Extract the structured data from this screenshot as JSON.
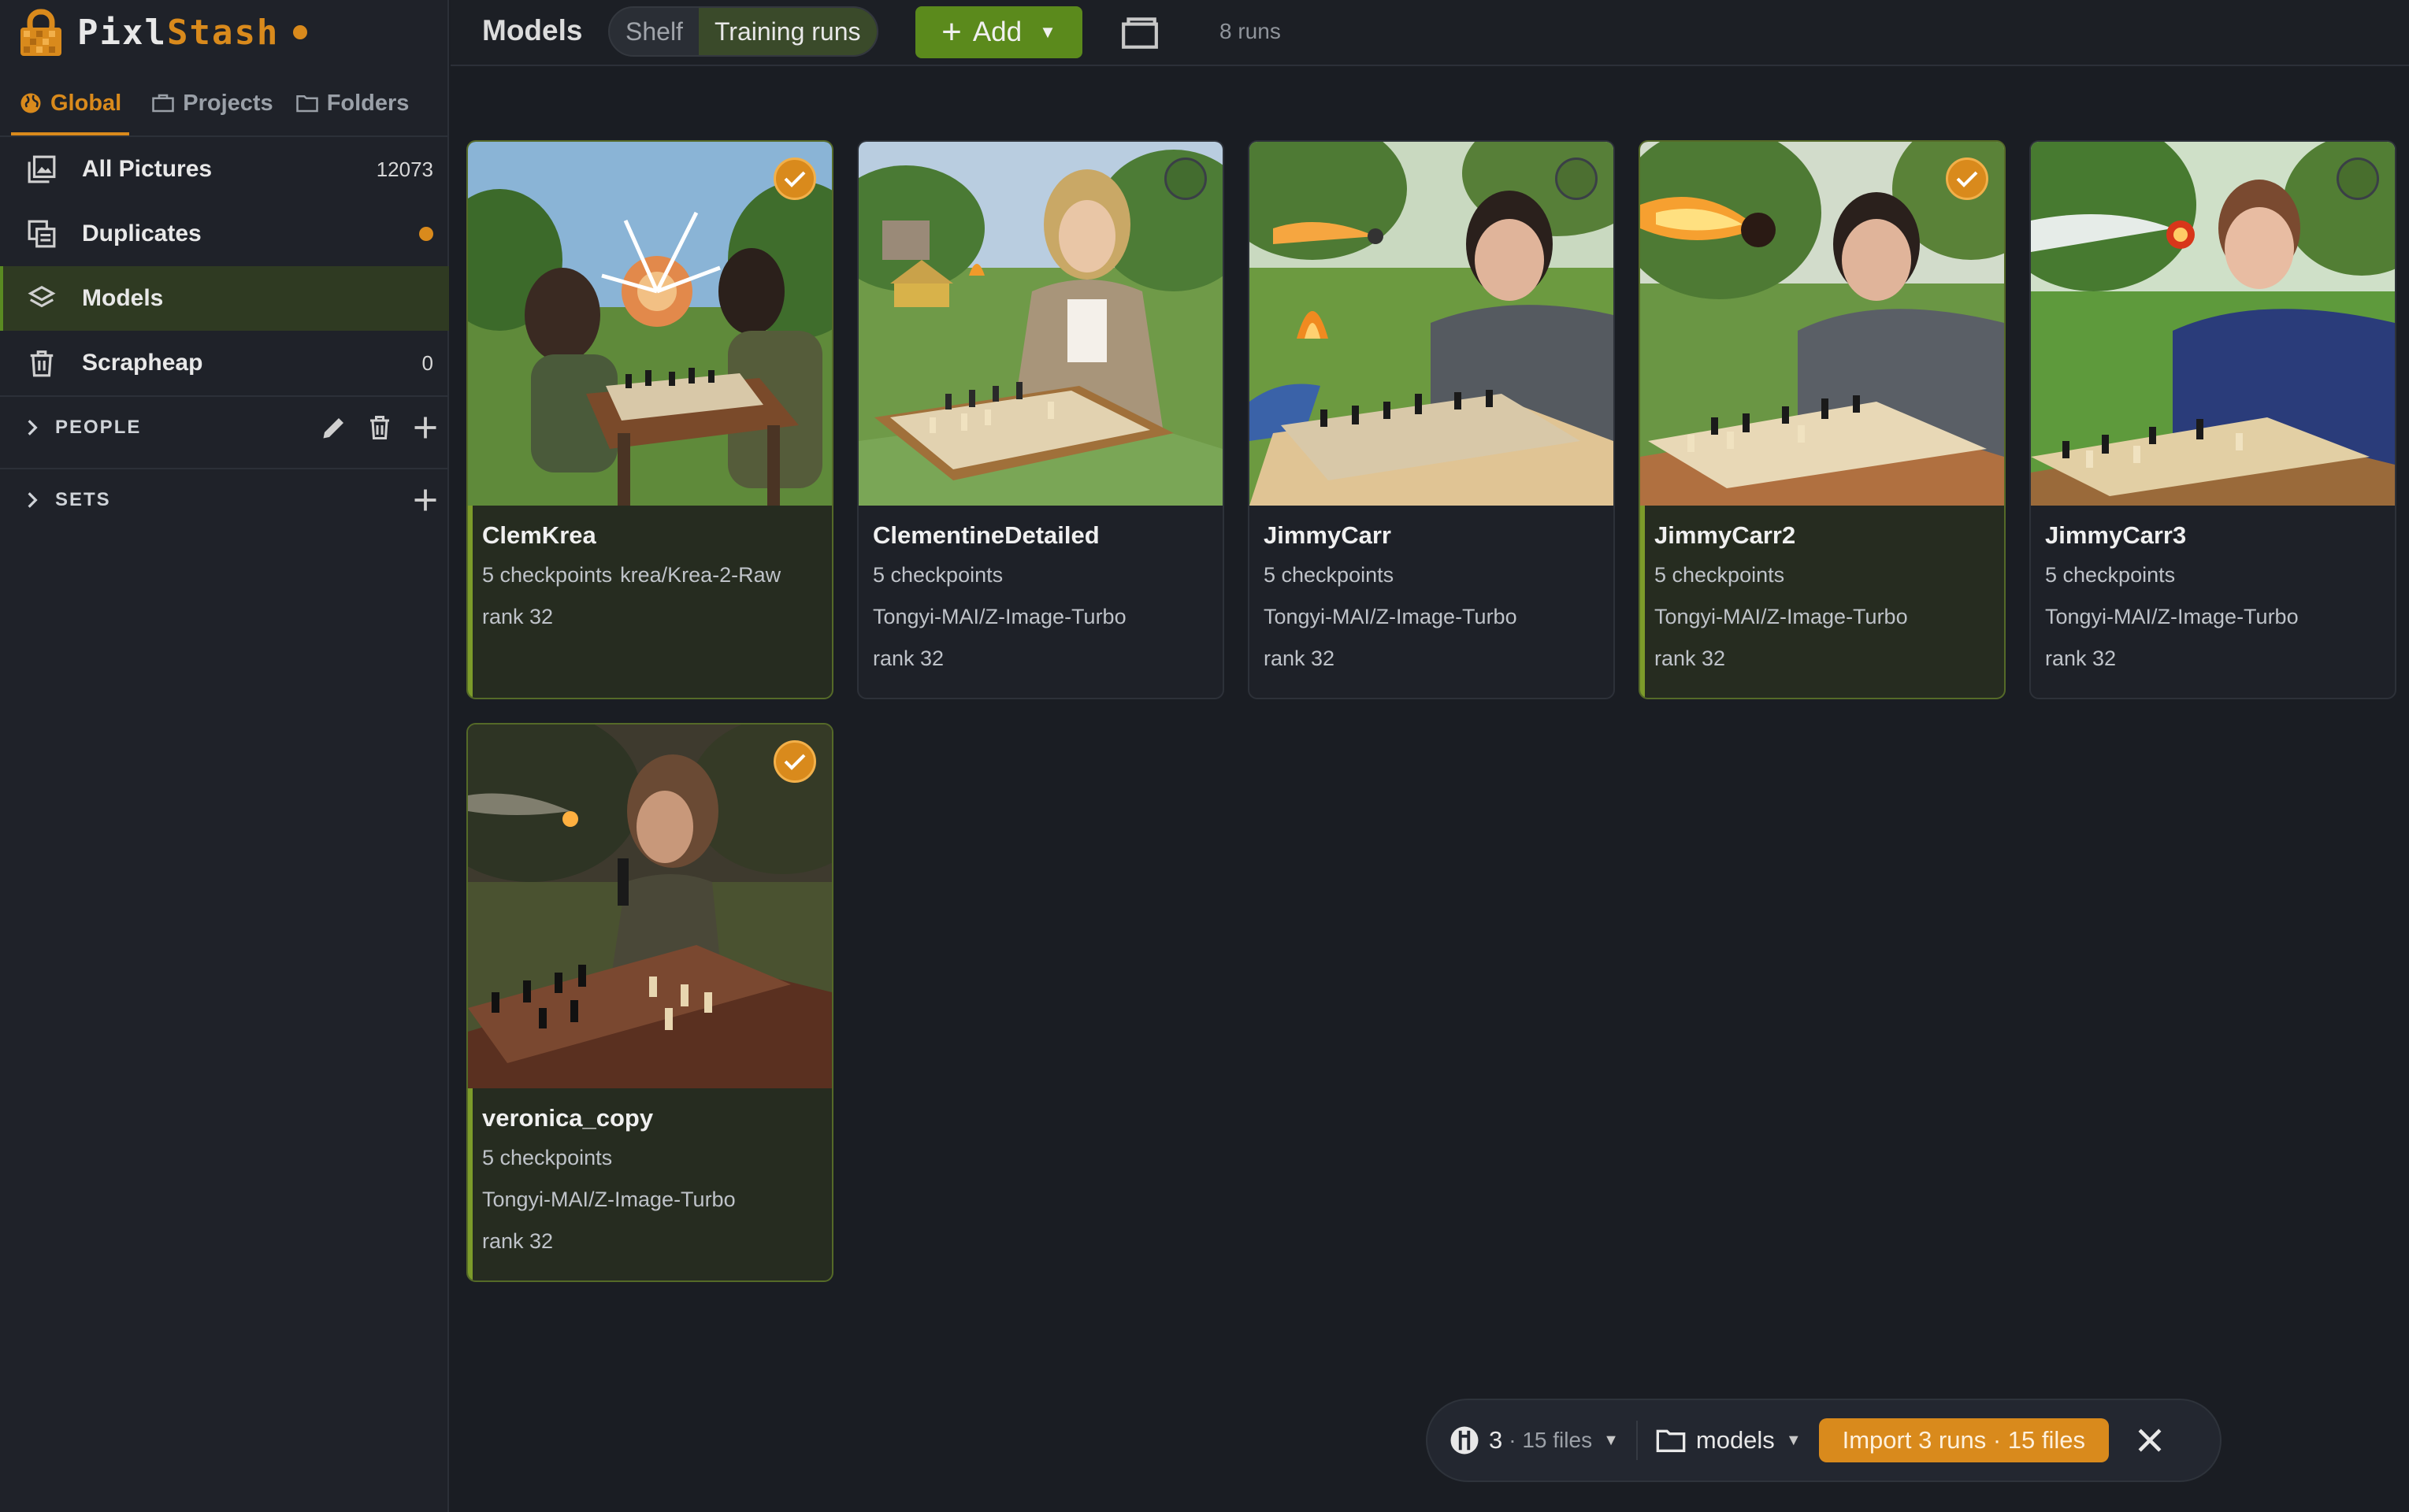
{
  "brand": {
    "name_part1": "Pixl",
    "name_part2": "Stash"
  },
  "scope_tabs": [
    {
      "label": "Global"
    },
    {
      "label": "Projects"
    },
    {
      "label": "Folders"
    }
  ],
  "nav": {
    "items": [
      {
        "label": "All Pictures",
        "count": "12073"
      },
      {
        "label": "Duplicates"
      },
      {
        "label": "Models"
      },
      {
        "label": "Scrapheap",
        "count": "0"
      }
    ]
  },
  "sections": {
    "people": "PEOPLE",
    "sets": "SETS"
  },
  "topbar": {
    "title": "Models",
    "view_tabs": [
      "Shelf",
      "Training runs"
    ],
    "add_label": "Add",
    "run_count": "8 runs"
  },
  "cards": [
    {
      "name": "ClemKrea",
      "checkpoints": "5 checkpoints",
      "model": "krea/Krea-2-Raw",
      "rank": "rank 32",
      "selected": true
    },
    {
      "name": "ClementineDetailed",
      "checkpoints": "5 checkpoints",
      "model": "Tongyi-MAI/Z-Image-Turbo",
      "rank": "rank 32",
      "selected": false
    },
    {
      "name": "JimmyCarr",
      "checkpoints": "5 checkpoints",
      "model": "Tongyi-MAI/Z-Image-Turbo",
      "rank": "rank 32",
      "selected": false
    },
    {
      "name": "JimmyCarr2",
      "checkpoints": "5 checkpoints",
      "model": "Tongyi-MAI/Z-Image-Turbo",
      "rank": "rank 32",
      "selected": true
    },
    {
      "name": "JimmyCarr3",
      "checkpoints": "5 checkpoints",
      "model": "Tongyi-MAI/Z-Image-Turbo",
      "rank": "rank 32",
      "selected": false
    },
    {
      "name": "veronica_copy",
      "checkpoints": "5 checkpoints",
      "model": "Tongyi-MAI/Z-Image-Turbo",
      "rank": "rank 32",
      "selected": true
    }
  ],
  "import_bar": {
    "runs": "3",
    "files": "· 15 files",
    "folder": "models",
    "import_label": "Import 3 runs · 15 files"
  },
  "colors": {
    "accent": "#d98a1c",
    "green": "#5b8a1c",
    "selected_bg": "#262c20"
  },
  "icons": [
    "lock-logo-icon",
    "globe-icon",
    "folder-icon",
    "pictures-icon",
    "duplicates-icon",
    "layers-icon",
    "trash-icon",
    "chevron-right-icon",
    "pencil-icon",
    "plus-icon",
    "caret-down-icon",
    "check-icon",
    "checkpoint-icon",
    "close-icon"
  ]
}
